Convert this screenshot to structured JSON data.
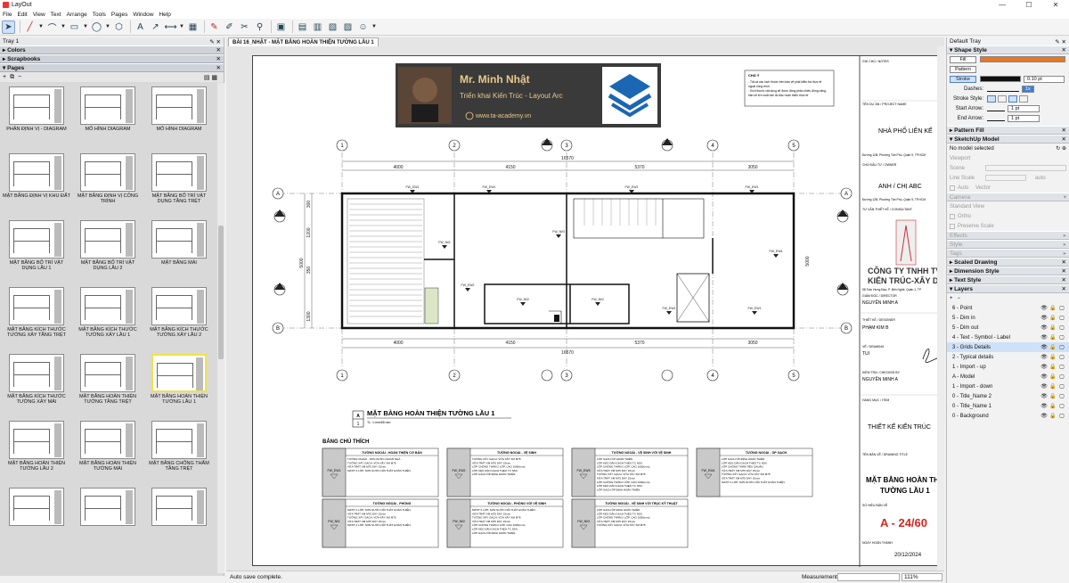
{
  "app": {
    "title": "LayOut",
    "window_controls": [
      "—",
      "☐",
      "✕"
    ]
  },
  "menu": [
    "File",
    "Edit",
    "View",
    "Text",
    "Arrange",
    "Tools",
    "Pages",
    "Window",
    "Help"
  ],
  "left_tray": {
    "title": "Tray 1",
    "panels": [
      {
        "label": "Colors"
      },
      {
        "label": "Scrapbooks"
      },
      {
        "label": "Pages"
      }
    ],
    "pages_toolbar": [
      "+",
      "⧉",
      "−"
    ],
    "pages": [
      "PHÂN ĐỊNH VỊ - DIAGRAM",
      "MÔ HÌNH DIAGRAM",
      "MÔ HÌNH DIAGRAM",
      "MẶT BẰNG ĐỊNH VỊ KHU ĐẤT",
      "MẶT BẰNG ĐỊNH VỊ CÔNG TRÌNH",
      "MẶT BẰNG BỐ TRÍ VẬT DỤNG TẦNG TRỆT",
      "MẶT BẰNG BỐ TRÍ VẬT DỤNG LẦU 1",
      "MẶT BẰNG BỐ TRÍ VẬT DỤNG LẦU 2",
      "MẶT BẰNG MÁI",
      "MẶT BẰNG KÍCH THƯỚC TƯỜNG XÂY TẦNG TRỆT",
      "MẶT BẰNG KÍCH THƯỚC TƯỜNG XÂY LẦU 1",
      "MẶT BẰNG KÍCH THƯỚC TƯỜNG XÂY LẦU 2",
      "MẶT BẰNG KÍCH THƯỚC TƯỜNG XÂY MÁI",
      "MẶT BẰNG HOÀN THIỆN TƯỜNG TẦNG TRỆT",
      "MẶT BẰNG HOÀN THIỆN TƯỜNG LẦU 1",
      "MẶT BẰNG HOÀN THIỆN TƯỜNG LẦU 2",
      "MẶT BẰNG HOÀN THIỆN TƯỜNG MÁI",
      "MẶT BẰNG CHỐNG THẤM TẦNG TRỆT",
      "",
      "",
      ""
    ],
    "selected_page": 14
  },
  "document": {
    "tab": "BÀI 16_NHẬT - MẶT BẰNG HOÀN THIỆN TƯỜNG LẦU 1",
    "banner": {
      "name": "Mr. Minh Nhật",
      "subtitle": "Triển khai Kiến Trúc - Layout Arc",
      "url": "www.ta-academy.vn"
    },
    "notes_title": "CHÚ Ý",
    "notes": [
      "- Tất cả các kích thước trên bản vẽ phải kiểm tra thực tế",
      "ngoài công trình.",
      "- Kích thước vật dụng sẽ được đồng phản chiếu đồng nặng,",
      "bản vẽ lớn xuất cần đo đạc hoàn thiện thực tế."
    ],
    "grid_cols": [
      "1",
      "2",
      "3",
      "4",
      "5"
    ],
    "grid_rows": [
      "A",
      "B"
    ],
    "dims_top": [
      "4000",
      "4150",
      "5370",
      "3050"
    ],
    "dims_total": "16570",
    "dims_side": [
      "5000",
      "1300",
      "1200",
      "300",
      "5000",
      "1300",
      "350"
    ],
    "drawing_title": "MẶT BẰNG HOÀN THIỆN TƯỜNG LẦU 1",
    "drawing_scale": "TL: 1:mm/65 mm",
    "drawing_id": "A",
    "drawing_num": "1",
    "legend_title": "BẢNG CHÚ THÍCH",
    "legend": [
      {
        "code": "FW_EW1",
        "title": "TƯỜNG NGOÀI - HOÀN THIỆN CƠ BẢN",
        "lines": [
          "TƯỜNG NGOÀI - SƠN NƯỚC NGOÀI NHÀ",
          "TƯỜNG XÂY GẠCH: VỮA XÂY XM M75",
          "VỮA TRÁT XM M75 DÀY 15mm",
          "MATIT 2 LỚP, SƠN NƯỚC NỘI THẤT HOÀN THIỆN."
        ]
      },
      {
        "code": "FW_EW2",
        "title": "TƯỜNG NGOÀI - VỆ SINH",
        "lines": [
          "TƯỜNG XÂY GẠCH: VỮA XÂY XM M75",
          "VỮA TRÁT XM M75 DÀY 15mm",
          "LỚP CHỐNG THẤM 2 LỚP, CAO 1000(mm).",
          "LỚP KEO DÁN GẠCH THEO TC NSX.",
          "LỚP GẠCH ỐP ĐỊNH HOÀN THIỆN."
        ]
      },
      {
        "code": "FW_EW3",
        "title": "TƯỜNG NGOÀI - VỆ SINH VỚI VỆ SINH",
        "lines": [
          "LỚP GẠCH ỐP HOÀN THIỆN",
          "LỚP KEO DÁN GẠCH THEO TC NSX.",
          "LỚP CHỐNG THẤM 2 LỚP, CAO 1000(mm).",
          "VỮA TRÁT XM M75 DÀY 15mm",
          "TƯỜNG XÂY GẠCH: VỮA XÂY XM M75",
          "VỮA TRÁT XM M75 DÀY 15mm",
          "LỚP CHỐNG THẤM 2 LỚP, CAO 1000(mm).",
          "LỚP KEO DÁN GẠCH THEO TC NSX.",
          "LỚP GẠCH ỐP ĐỊNH HOÀN THIỆN."
        ]
      },
      {
        "code": "FW_EW4",
        "title": "TƯỜNG NGOÀI - ỐP GẠCH",
        "lines": [
          "LỚP GẠCH ỐP ĐỊNH HOÀN THIỆN",
          "LỚP KEO DÁN GẠCH THEO TC NSX.",
          "LỚP CHỐNG THẤM TIÊU CHUẨN.",
          "VỮA TRÁT XM M75 DÀY 15mm",
          "TƯỜNG XÂY GẠCH: VỮA XÂY XM M75",
          "VỮA TRÁT XM M75 DÀY 15mm",
          "MATIT 2 LỚP, SƠN NƯỚC NỘI THẤT HOÀN THIỆN."
        ]
      },
      {
        "code": "FW_IW1",
        "title": "TƯỜNG NGOÀI - PHÒNG",
        "lines": [
          "MATIT 2 LỚP, SƠN NƯỚC NỘI THẤT HOÀN THIỆN.",
          "VỮA TRÁT XM M75 DÀY 15mm",
          "TƯỜNG XÂY GẠCH: VỮA XÂY XM M75",
          "VỮA TRÁT XM M75 DÀY 15mm",
          "MATIT 2 LỚP, SƠN NƯỚC NỘI THẤT HOÀN THIỆN."
        ]
      },
      {
        "code": "FW_IW2",
        "title": "TƯỜNG NGOÀI - PHÒNG VỚI VỆ SINH",
        "lines": [
          "MATIT 2 LỚP, SƠN NƯỚC NỘI THẤT HOÀN THIỆN.",
          "VỮA TRÁT XM M75 DÀY 15mm",
          "TƯỜNG XÂY GẠCH: VỮA XÂY XM M75",
          "VỮA TRÁT XM M75 DÀY 15mm",
          "LỚP CHỐNG THẤM 2 LỚP, CAO 1000(mm).",
          "LỚP KEO DÁN GẠCH THEO TC NSX.",
          "LỚP GẠCH ỐP ĐỊNH HOÀN THIỆN."
        ]
      },
      {
        "code": "FW_IW3",
        "title": "TƯỜNG NGOÀI - VỆ SINH VỚI TRỤC KỸ THUẬT",
        "lines": [
          "LỚP GẠCH ỐP ĐỊNH HOÀN THIỆN",
          "LỚP KEO DÁN GẠCH THEO TC NSX.",
          "LỚP CHỐNG THẤM 2 LỚP, CAO 1000(mm).",
          "VỮA TRÁT XM M75 DÀY 15mm",
          "TƯỜNG XÂY GẠCH: VỮA XÂY XM M75"
        ]
      }
    ],
    "titleblock": {
      "notes_label": "GHI CHÚ / NOTES",
      "project_label": "TÊN DỰ ÁN / PROJECT NAME",
      "project": "NHÀ PHỐ LIÊN KẾ",
      "address": "Đường 12B, Phường Tân Phú, Quận 9, TP.HCM",
      "owner_label": "CHỦ ĐẦU TƯ / OWNER",
      "owner": "ANH / CHỊ ABC",
      "owner_address": "Đường 12B, Phường Tân Phú, Quận 9, TP.HCM",
      "consultant_label": "TƯ VẤN THIẾT KẾ / CONSULTANT",
      "company": "CÔNG TY TNHH TV",
      "company2": "KIẾN TRÚC-XÂY DỰ",
      "company_address": "58 Trần Hưng Đạo, P. Bến Nghé, Quận 1, TP",
      "director_label": "GIÁM ĐỐC / DIRECTOR",
      "director": "NGUYỄN MINH A",
      "designer_label": "THIẾT KẾ / DESIGNER",
      "designer": "PHẠM KIM B",
      "drawn_label": "VẼ / DRAWING",
      "drawn": "TUI",
      "checked_label": "KIỂM TRA / CHECKED BY",
      "checked": "NGUYỄN MINH A",
      "item_label": "HẠNG MỤC / ITEM",
      "item": "THIẾT KẾ KIẾN TRÚC",
      "drawing_title_label": "TÊN BẢN VẼ / DRAWING TITLE",
      "drawing_title": "MẶT BẰNG HOÀN TH",
      "drawing_title2": "TƯỜNG LẦU 1",
      "sheet_label": "SỐ HIỆU BẢN VẼ",
      "sheet": "A - 24/60",
      "date_label": "NGÀY HOÀN THÀNH",
      "date": "20/12/2024"
    }
  },
  "status": {
    "message": "Auto save complete.",
    "measurements_label": "Measurements",
    "zoom": "111%"
  },
  "right_tray": {
    "title": "Default Tray",
    "shape_style": {
      "label": "Shape Style",
      "fill": "Fill",
      "fill_color": "#e87722",
      "pattern": "Pattern",
      "stroke": "Stroke",
      "stroke_color": "#111111",
      "stroke_width": "0.10 pt",
      "dashes": "Dashes:",
      "dash_scale": "1x",
      "stroke_style": "Stroke Style:",
      "start_arrow": "Start Arrow:",
      "start_size": "1 pt",
      "end_arrow": "End Arrow:",
      "end_size": "1 pt"
    },
    "pattern_fill": "Pattern Fill",
    "sketchup": {
      "label": "SketchUp Model",
      "no_model": "No model selected",
      "viewport": "Viewport",
      "scene": "Scene",
      "line_scale": "Line Scale",
      "auto": "auto",
      "auto2": "Auto",
      "vector": "Vector",
      "camera": "Camera",
      "standard_view": "Standard View",
      "ortho": "Ortho",
      "preserve": "Preserve Scale",
      "effects": "Effects",
      "style": "Style",
      "tags": "Tags"
    },
    "sections": [
      "Scaled Drawing",
      "Dimension Style",
      "Text Style"
    ],
    "layers_label": "Layers",
    "layers": [
      "6 - Point",
      "5 - Dim in",
      "5 - Dim out",
      "4 - Text - Symbol - Label",
      "3 - Grids Details",
      "2 - Typical details",
      "1 - Import - up",
      "A - Model",
      "1 - Import - down",
      "0 - Title_Name 2",
      "0 - Title_Name 1",
      "0 - Background"
    ],
    "selected_layer": 4
  }
}
